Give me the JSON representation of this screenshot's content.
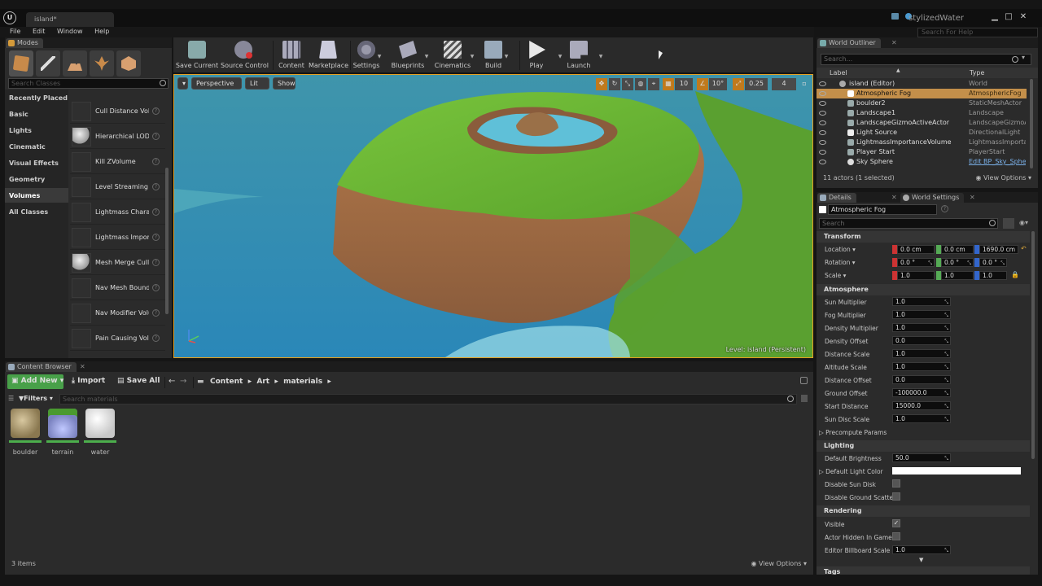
{
  "window": {
    "tab_title": "island*",
    "project_name": "stylizedWater",
    "help_search_placeholder": "Search For Help"
  },
  "menu": [
    "File",
    "Edit",
    "Window",
    "Help"
  ],
  "modes": {
    "tab_label": "Modes",
    "search_placeholder": "Search Classes",
    "categories": [
      "Recently Placed",
      "Basic",
      "Lights",
      "Cinematic",
      "Visual Effects",
      "Geometry",
      "Volumes",
      "All Classes"
    ],
    "active_category": "Volumes",
    "items": [
      "Cull Distance Vol",
      "Hierarchical LODVol",
      "Kill ZVolume",
      "Level Streaming",
      "Lightmass Chara",
      "Lightmass Impor",
      "Mesh Merge Culling",
      "Nav Mesh Bound",
      "Nav Modifier Volu",
      "Pain Causing Volu"
    ]
  },
  "toolbar": [
    "Save Current",
    "Source Control",
    "Content",
    "Marketplace",
    "Settings",
    "Blueprints",
    "Cinematics",
    "Build",
    "Play",
    "Launch"
  ],
  "viewport": {
    "perspective_label": "Perspective",
    "lit_label": "Lit",
    "show_label": "Show",
    "grid_snap": "10",
    "rotation_snap": "10°",
    "scale_snap": "0.25",
    "camera_speed": "4",
    "level_label": "Level:  island (Persistent)"
  },
  "outliner": {
    "tab_label": "World Outliner",
    "search_placeholder": "Search...",
    "col_label": "Label",
    "col_type": "Type",
    "rows": [
      {
        "label": "island (Editor)",
        "type": "World"
      },
      {
        "label": "Atmospheric Fog",
        "type": "AtmosphericFog"
      },
      {
        "label": "boulder2",
        "type": "StaticMeshActor"
      },
      {
        "label": "Landscape1",
        "type": "Landscape"
      },
      {
        "label": "LandscapeGizmoActiveActor",
        "type": "LandscapeGizmoAc"
      },
      {
        "label": "Light Source",
        "type": "DirectionalLight"
      },
      {
        "label": "LightmassImportanceVolume",
        "type": "LightmassImportar"
      },
      {
        "label": "Player Start",
        "type": "PlayerStart"
      },
      {
        "label": "Sky Sphere",
        "type": "Edit BP_Sky_Sphe"
      }
    ],
    "status": "11 actors (1 selected)",
    "view_options": "View Options"
  },
  "details": {
    "tab_label": "Details",
    "world_settings_label": "World Settings",
    "actor_name": "Atmospheric Fog",
    "search_placeholder": "Search",
    "transform": {
      "title": "Transform",
      "location_label": "Location",
      "location": [
        "0.0 cm",
        "0.0 cm",
        "1690.0 cm"
      ],
      "rotation_label": "Rotation",
      "rotation": [
        "0.0 °",
        "0.0 °",
        "0.0 °"
      ],
      "scale_label": "Scale",
      "scale": [
        "1.0",
        "1.0",
        "1.0"
      ]
    },
    "atmosphere": {
      "title": "Atmosphere",
      "props": [
        {
          "name": "Sun Multiplier",
          "value": "1.0"
        },
        {
          "name": "Fog Multiplier",
          "value": "1.0"
        },
        {
          "name": "Density Multiplier",
          "value": "1.0"
        },
        {
          "name": "Density Offset",
          "value": "0.0"
        },
        {
          "name": "Distance Scale",
          "value": "1.0"
        },
        {
          "name": "Altitude Scale",
          "value": "1.0"
        },
        {
          "name": "Distance Offset",
          "value": "0.0"
        },
        {
          "name": "Ground Offset",
          "value": "-100000.0"
        },
        {
          "name": "Start Distance",
          "value": "15000.0"
        },
        {
          "name": "Sun Disc Scale",
          "value": "1.0"
        }
      ],
      "precompute_label": "Precompute Params"
    },
    "lighting": {
      "title": "Lighting",
      "default_brightness_label": "Default Brightness",
      "default_brightness": "50.0",
      "default_light_color_label": "Default Light Color",
      "disable_sun_disk_label": "Disable Sun Disk",
      "disable_ground_scatter_label": "Disable Ground Scatteri"
    },
    "rendering": {
      "title": "Rendering",
      "visible_label": "Visible",
      "actor_hidden_label": "Actor Hidden In Game",
      "billboard_scale_label": "Editor Billboard Scale",
      "billboard_scale": "1.0"
    },
    "tags_title": "Tags"
  },
  "content_browser": {
    "tab_label": "Content Browser",
    "add_new": "Add New",
    "import": "Import",
    "save_all": "Save All",
    "path": [
      "Content",
      "Art",
      "materials"
    ],
    "filters": "Filters",
    "search_placeholder": "Search materials",
    "assets": [
      "boulder",
      "terrain",
      "water"
    ],
    "item_count": "3 items",
    "view_options": "View Options"
  }
}
